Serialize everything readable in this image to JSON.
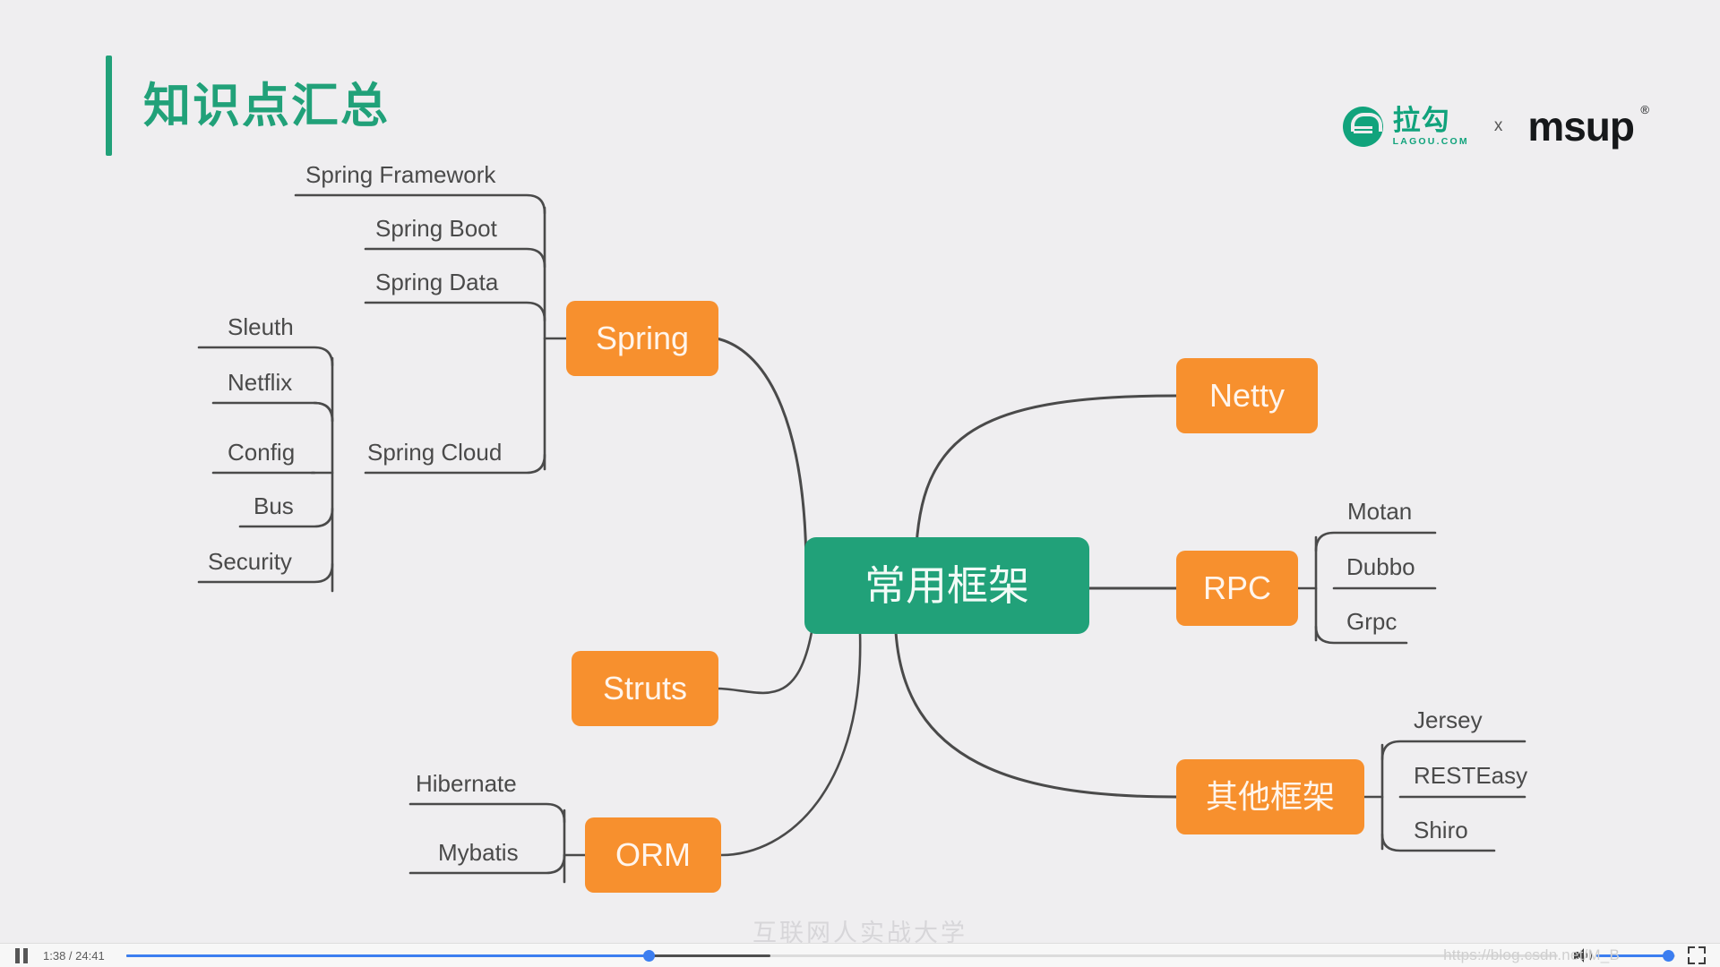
{
  "slide": {
    "title": "知识点汇总",
    "watermark": "互联网人实战大学",
    "brand": {
      "lagou_cn": "拉勾",
      "lagou_en": "LAGOU.COM",
      "separator": "x",
      "msup": "msup",
      "msup_reg": "®"
    },
    "colors": {
      "background": "#EFEEF0",
      "accent_green": "#21A179",
      "node_orange": "#F7902E",
      "node_text": "#FFF5EC",
      "leaf_text": "#4A4A4A",
      "connector": "#4A4A4A"
    }
  },
  "mindmap": {
    "center": {
      "label": "常用框架"
    },
    "branches": [
      {
        "id": "spring",
        "label": "Spring",
        "side": "left",
        "children": [
          {
            "label": "Spring Framework"
          },
          {
            "label": "Spring Boot"
          },
          {
            "label": "Spring Data"
          },
          {
            "label": "Spring Cloud",
            "children": [
              {
                "label": "Sleuth"
              },
              {
                "label": "Netflix"
              },
              {
                "label": "Config"
              },
              {
                "label": "Bus"
              },
              {
                "label": "Security"
              }
            ]
          }
        ]
      },
      {
        "id": "struts",
        "label": "Struts",
        "side": "left",
        "children": []
      },
      {
        "id": "orm",
        "label": "ORM",
        "side": "left",
        "children": [
          {
            "label": "Hibernate"
          },
          {
            "label": "Mybatis"
          }
        ]
      },
      {
        "id": "netty",
        "label": "Netty",
        "side": "right",
        "children": []
      },
      {
        "id": "rpc",
        "label": "RPC",
        "side": "right",
        "children": [
          {
            "label": "Motan"
          },
          {
            "label": "Dubbo"
          },
          {
            "label": "Grpc"
          }
        ]
      },
      {
        "id": "other",
        "label": "其他框架",
        "side": "right",
        "children": [
          {
            "label": "Jersey"
          },
          {
            "label": "RESTEasy"
          },
          {
            "label": "Shiro"
          }
        ]
      }
    ]
  },
  "player": {
    "pause_icon": "pause-icon",
    "time": "1:38 / 24:41",
    "current_time": "1:38",
    "duration": "24:41",
    "progress_percent": 36.5,
    "buffer_percent": 45,
    "volume_percent": 92,
    "volume_icon": "volume-icon",
    "fullscreen_icon": "fullscreen-exit-icon",
    "url_watermark": "https://blog.csdn.net/M_B"
  }
}
